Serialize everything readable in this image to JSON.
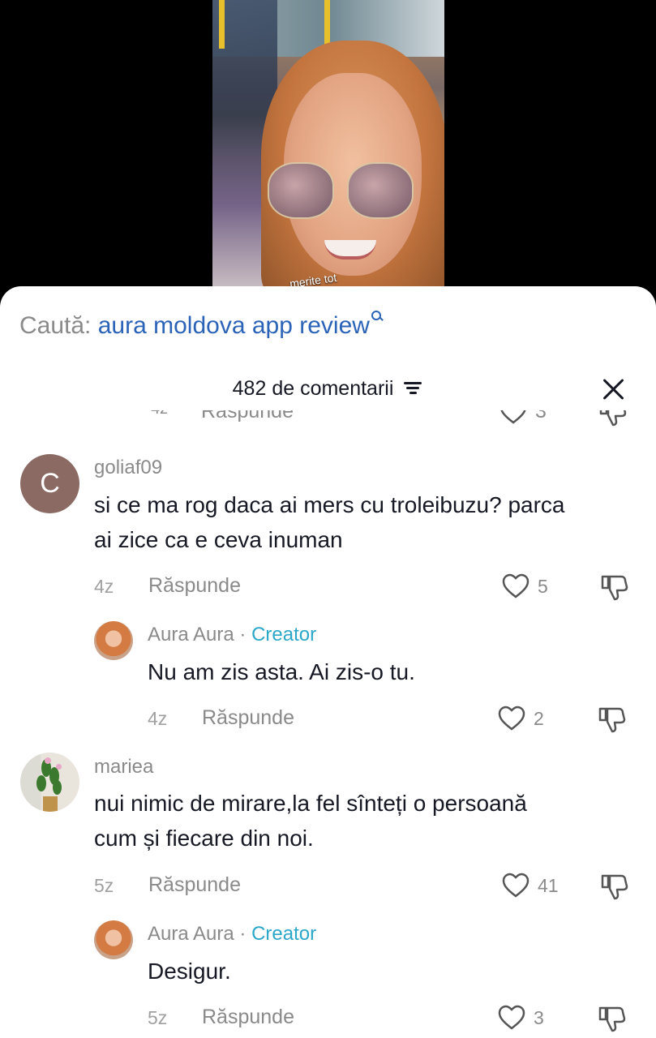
{
  "video": {
    "caption": "merite tot"
  },
  "search": {
    "label": "Caută: ",
    "query": "aura moldova app review"
  },
  "header": {
    "title": "482 de comentarii"
  },
  "peek": {
    "time": "4z",
    "reply": "Răspunde",
    "likes": "3"
  },
  "comments": [
    {
      "avatar": "C",
      "username": "goliaf09",
      "lines": [
        "si ce ma rog daca ai mers cu troleibuzu? parca",
        "ai zice ca e ceva inuman"
      ],
      "time": "4z",
      "reply": "Răspunde",
      "likes": "5",
      "replies": [
        {
          "username": "Aura Aura",
          "sep": " · ",
          "tag": "Creator",
          "text": "Nu am zis asta. Ai zis-o tu.",
          "time": "4z",
          "reply": "Răspunde",
          "likes": "2"
        }
      ]
    },
    {
      "avatar": "plant-avatar",
      "username": "mariea",
      "lines": [
        "nui nimic de mirare,la fel sînteți o persoană",
        "cum și fiecare din noi."
      ],
      "time": "5z",
      "reply": "Răspunde",
      "likes": "41",
      "replies": [
        {
          "username": "Aura Aura",
          "sep": " · ",
          "tag": "Creator",
          "text": "Desigur.",
          "time": "5z",
          "reply": "Răspunde",
          "likes": "3"
        }
      ]
    }
  ],
  "colors": {
    "link": "#2b63b8",
    "creator": "#2aa7c9",
    "muted": "#8a8a8a",
    "text": "#161823"
  },
  "icons": [
    "search-icon",
    "sort-icon",
    "close-icon",
    "heart-icon",
    "dislike-icon"
  ]
}
